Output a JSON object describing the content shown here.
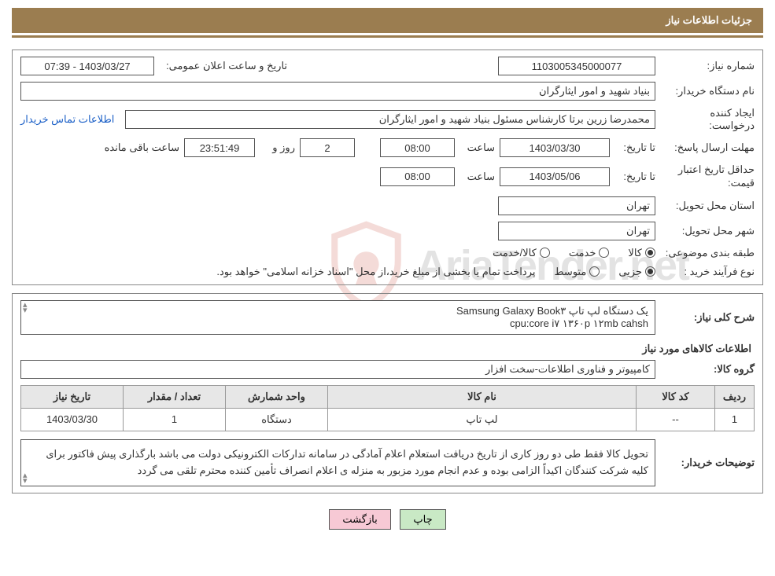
{
  "header": {
    "title": "جزئیات اطلاعات نیاز"
  },
  "need": {
    "need_number_label": "شماره نیاز:",
    "need_number": "1103005345000077",
    "announce_label": "تاریخ و ساعت اعلان عمومی:",
    "announce_value": "1403/03/27 - 07:39",
    "org_label": "نام دستگاه خریدار:",
    "org_value": "بنیاد شهید و امور ایثارگران",
    "requester_label": "ایجاد کننده درخواست:",
    "requester_value": "محمدرضا زرین برتا کارشناس مسئول  بنیاد شهید و امور ایثارگران",
    "contact_link": "اطلاعات تماس خریدار",
    "deadline_label": "مهلت ارسال پاسخ:",
    "until_prefix": "تا تاریخ:",
    "deadline_date": "1403/03/30",
    "time_label": "ساعت",
    "deadline_time": "08:00",
    "days_value": "2",
    "days_label": "روز و",
    "remaining_time": "23:51:49",
    "remaining_label": "ساعت باقی مانده",
    "min_valid_label": "حداقل تاریخ اعتبار قیمت:",
    "min_valid_date": "1403/05/06",
    "min_valid_time": "08:00",
    "province_label": "استان محل تحویل:",
    "province_value": "تهران",
    "city_label": "شهر محل تحویل:",
    "city_value": "تهران",
    "category_label": "طبقه بندی موضوعی:",
    "kala": "کالا",
    "khedmat": "خدمت",
    "kala_khedmat": "کالا/خدمت",
    "process_label": "نوع فرآیند خرید :",
    "partial": "جزیی",
    "medium": "متوسط",
    "process_note": "پرداخت تمام یا بخشی از مبلغ خرید،از محل \"اسناد خزانه اسلامی\" خواهد بود."
  },
  "desc": {
    "desc_label": "شرح کلی نیاز:",
    "line1": "یک دستگاه لپ تاپ Samsung Galaxy Book۳",
    "line2": "cpu:core i۷ ۱۳۶۰p ۱۲mb cahsh",
    "items_title": "اطلاعات کالاهای مورد نیاز",
    "group_label": "گروه کالا:",
    "group_value": "کامپیوتر و فناوری اطلاعات-سخت افزار"
  },
  "table": {
    "h_row": "ردیف",
    "h_code": "کد کالا",
    "h_name": "نام کالا",
    "h_unit": "واحد شمارش",
    "h_qty": "تعداد / مقدار",
    "h_date": "تاریخ نیاز",
    "rows": [
      {
        "row": "1",
        "code": "--",
        "name": "لپ تاپ",
        "unit": "دستگاه",
        "qty": "1",
        "date": "1403/03/30"
      }
    ]
  },
  "buyer_note": {
    "label": "توضیحات خریدار:",
    "text": "تحویل کالا فقط طی دو روز کاری از تاریخ دریافت استعلام اعلام آمادگی در سامانه تدارکات الکترونیکی دولت می باشد بارگذاری پیش فاکتور برای کلیه شرکت کنندگان اکیداً الزامی بوده و عدم انجام مورد مزبور به منزله ی اعلام انصراف تأمین کننده محترم تلقی می گردد"
  },
  "footer": {
    "print": "چاپ",
    "back": "بازگشت"
  },
  "watermark": {
    "text": "AriaTender.net"
  }
}
